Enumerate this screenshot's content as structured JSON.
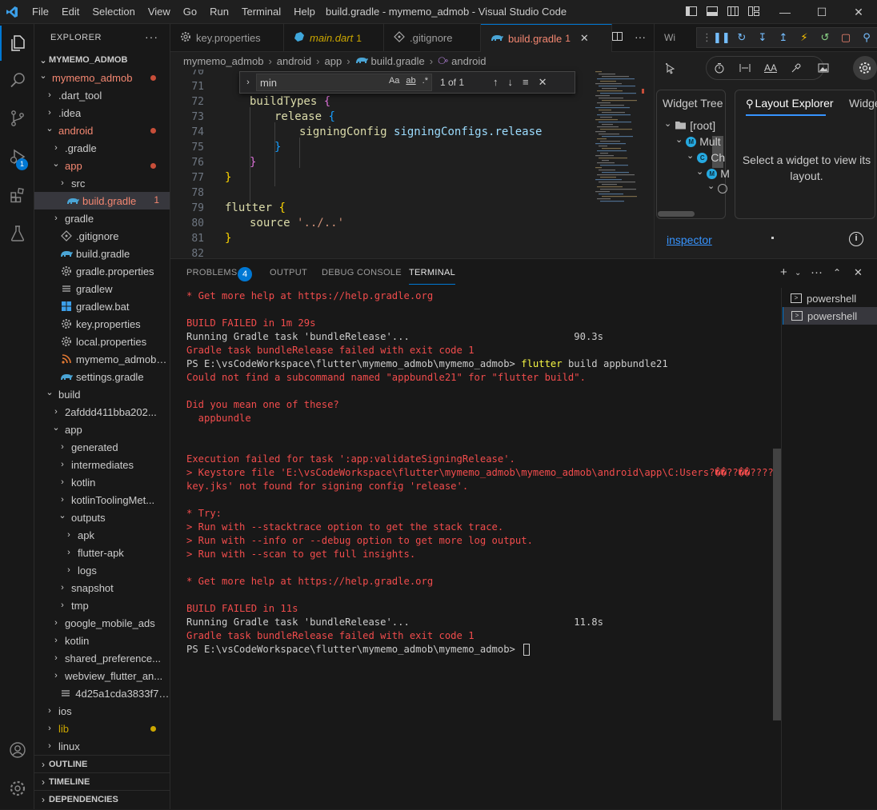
{
  "titlebar": {
    "menu": [
      "File",
      "Edit",
      "Selection",
      "View",
      "Go",
      "Run",
      "Terminal",
      "Help"
    ],
    "window_title": "build.gradle - mymemo_admob - Visual Studio Code"
  },
  "activity": {
    "debug_badge": "1"
  },
  "explorer": {
    "title": "EXPLORER",
    "root": "MYMEMO_ADMOB",
    "items": [
      {
        "label": "mymemo_admob",
        "depth": 1,
        "chev": "open",
        "color": "#f48771",
        "dot": "#c74e39"
      },
      {
        "label": ".dart_tool",
        "depth": 2,
        "chev": "closed"
      },
      {
        "label": ".idea",
        "depth": 2,
        "chev": "closed"
      },
      {
        "label": "android",
        "depth": 2,
        "chev": "open",
        "color": "#f48771",
        "dot": "#c74e39"
      },
      {
        "label": ".gradle",
        "depth": 3,
        "chev": "closed"
      },
      {
        "label": "app",
        "depth": 3,
        "chev": "open",
        "color": "#f48771",
        "dot": "#c74e39"
      },
      {
        "label": "src",
        "depth": 4,
        "chev": "closed"
      },
      {
        "label": "build.gradle",
        "depth": 4,
        "icon": "gradle",
        "color": "#f48771",
        "count": "1",
        "selected": true
      },
      {
        "label": "gradle",
        "depth": 3,
        "chev": "closed"
      },
      {
        "label": ".gitignore",
        "depth": 3,
        "icon": "git"
      },
      {
        "label": "build.gradle",
        "depth": 3,
        "icon": "gradle"
      },
      {
        "label": "gradle.properties",
        "depth": 3,
        "icon": "gear"
      },
      {
        "label": "gradlew",
        "depth": 3,
        "icon": "lines"
      },
      {
        "label": "gradlew.bat",
        "depth": 3,
        "icon": "windows"
      },
      {
        "label": "key.properties",
        "depth": 3,
        "icon": "gear"
      },
      {
        "label": "local.properties",
        "depth": 3,
        "icon": "gear"
      },
      {
        "label": "mymemo_admob_...",
        "depth": 3,
        "icon": "rss"
      },
      {
        "label": "settings.gradle",
        "depth": 3,
        "icon": "gradle"
      },
      {
        "label": "build",
        "depth": 2,
        "chev": "open"
      },
      {
        "label": "2afddd411bba202...",
        "depth": 3,
        "chev": "closed"
      },
      {
        "label": "app",
        "depth": 3,
        "chev": "open"
      },
      {
        "label": "generated",
        "depth": 4,
        "chev": "closed"
      },
      {
        "label": "intermediates",
        "depth": 4,
        "chev": "closed"
      },
      {
        "label": "kotlin",
        "depth": 4,
        "chev": "closed"
      },
      {
        "label": "kotlinToolingMet...",
        "depth": 4,
        "chev": "closed"
      },
      {
        "label": "outputs",
        "depth": 4,
        "chev": "open"
      },
      {
        "label": "apk",
        "depth": 5,
        "chev": "closed"
      },
      {
        "label": "flutter-apk",
        "depth": 5,
        "chev": "closed"
      },
      {
        "label": "logs",
        "depth": 5,
        "chev": "closed"
      },
      {
        "label": "snapshot",
        "depth": 4,
        "chev": "closed"
      },
      {
        "label": "tmp",
        "depth": 4,
        "chev": "closed"
      },
      {
        "label": "google_mobile_ads",
        "depth": 3,
        "chev": "closed"
      },
      {
        "label": "kotlin",
        "depth": 3,
        "chev": "closed"
      },
      {
        "label": "shared_preference...",
        "depth": 3,
        "chev": "closed"
      },
      {
        "label": "webview_flutter_an...",
        "depth": 3,
        "chev": "closed"
      },
      {
        "label": "4d25a1cda3833f76...",
        "depth": 3,
        "icon": "lines"
      },
      {
        "label": "ios",
        "depth": 2,
        "chev": "closed"
      },
      {
        "label": "lib",
        "depth": 2,
        "chev": "closed",
        "color": "#cca700",
        "dot": "#cca700"
      },
      {
        "label": "linux",
        "depth": 2,
        "chev": "closed"
      }
    ],
    "sections": [
      "OUTLINE",
      "TIMELINE",
      "DEPENDENCIES"
    ]
  },
  "tabs": [
    {
      "label": "key.properties",
      "icon": "gear"
    },
    {
      "label": "main.dart",
      "count": "1",
      "icon": "dart",
      "italic": true
    },
    {
      "label": ".gitignore",
      "icon": "git"
    },
    {
      "label": "build.gradle",
      "count": "1",
      "icon": "gradle",
      "active": true
    }
  ],
  "breadcrumb": [
    "mymemo_admob",
    "android",
    "app",
    "build.gradle",
    "android"
  ],
  "find": {
    "value": "min",
    "count": "1 of 1",
    "opt_case": "Aa",
    "opt_word": "ab",
    "opt_regex": ".*"
  },
  "code": [
    {
      "n": "70",
      "t": ""
    },
    {
      "n": "71",
      "t": ""
    },
    {
      "n": "72",
      "t": "buildTypes {"
    },
    {
      "n": "73",
      "t": "release {"
    },
    {
      "n": "74",
      "t": "signingConfig signingConfigs.release"
    },
    {
      "n": "75",
      "t": "}"
    },
    {
      "n": "76",
      "t": "}"
    },
    {
      "n": "77",
      "t": "}"
    },
    {
      "n": "78",
      "t": ""
    },
    {
      "n": "79",
      "t": "flutter {"
    },
    {
      "n": "80",
      "t": "source '../..'"
    },
    {
      "n": "81",
      "t": "}"
    },
    {
      "n": "82",
      "t": ""
    }
  ],
  "inspector": {
    "tab_label": "Wi",
    "widget_tree": "Widget Tree",
    "layout_explorer": "Layout Explorer",
    "widget_details": "Widge",
    "tree": [
      "[root]",
      "Mult",
      "Ch",
      "M",
      ""
    ],
    "tree_badges": [
      "M",
      "C",
      "M"
    ],
    "layout_message": "Select a widget to view its layout.",
    "inspector_link": "inspector",
    "tool_text": "AA"
  },
  "panel": {
    "tabs": [
      "PROBLEMS",
      "OUTPUT",
      "DEBUG CONSOLE",
      "TERMINAL"
    ],
    "problems_count": "4",
    "terminals": [
      "powershell",
      "powershell"
    ]
  },
  "terminal": [
    {
      "t": "* Get more help at https://help.gradle.org",
      "c": "err"
    },
    {
      "t": "",
      "c": "norm"
    },
    {
      "t": "BUILD FAILED in 1m 29s",
      "c": "err"
    },
    {
      "t": "Running Gradle task 'bundleRelease'...                            90.3s",
      "c": "norm"
    },
    {
      "t": "Gradle task bundleRelease failed with exit code 1",
      "c": "err"
    },
    {
      "t": "PS E:\\vsCodeWorkspace\\flutter\\mymemo_admob\\mymemo_admob> ",
      "c": "norm",
      "cmd": "flutter",
      "rest": " build appbundle21"
    },
    {
      "t": "Could not find a subcommand named \"appbundle21\" for \"flutter build\".",
      "c": "err"
    },
    {
      "t": "",
      "c": "norm"
    },
    {
      "t": "Did you mean one of these?",
      "c": "err"
    },
    {
      "t": "  appbundle",
      "c": "err"
    },
    {
      "t": "",
      "c": "norm"
    },
    {
      "t": "",
      "c": "norm"
    },
    {
      "t": "Execution failed for task ':app:validateSigningRelease'.",
      "c": "err"
    },
    {
      "t": "> Keystore file 'E:\\vsCodeWorkspace\\flutter\\mymemo_admob\\mymemo_admob\\android\\app\\C:Users?��??��?????",
      "c": "err"
    },
    {
      "t": "key.jks' not found for signing config 'release'.",
      "c": "err"
    },
    {
      "t": "",
      "c": "norm"
    },
    {
      "t": "* Try:",
      "c": "err"
    },
    {
      "t": "> Run with --stacktrace option to get the stack trace.",
      "c": "err"
    },
    {
      "t": "> Run with --info or --debug option to get more log output.",
      "c": "err"
    },
    {
      "t": "> Run with --scan to get full insights.",
      "c": "err"
    },
    {
      "t": "",
      "c": "norm"
    },
    {
      "t": "* Get more help at https://help.gradle.org",
      "c": "err"
    },
    {
      "t": "",
      "c": "norm"
    },
    {
      "t": "BUILD FAILED in 11s",
      "c": "err"
    },
    {
      "t": "Running Gradle task 'bundleRelease'...                            11.8s",
      "c": "norm"
    },
    {
      "t": "Gradle task bundleRelease failed with exit code 1",
      "c": "err"
    },
    {
      "t": "PS E:\\vsCodeWorkspace\\flutter\\mymemo_admob\\mymemo_admob> ",
      "c": "norm",
      "cursor": true
    }
  ]
}
